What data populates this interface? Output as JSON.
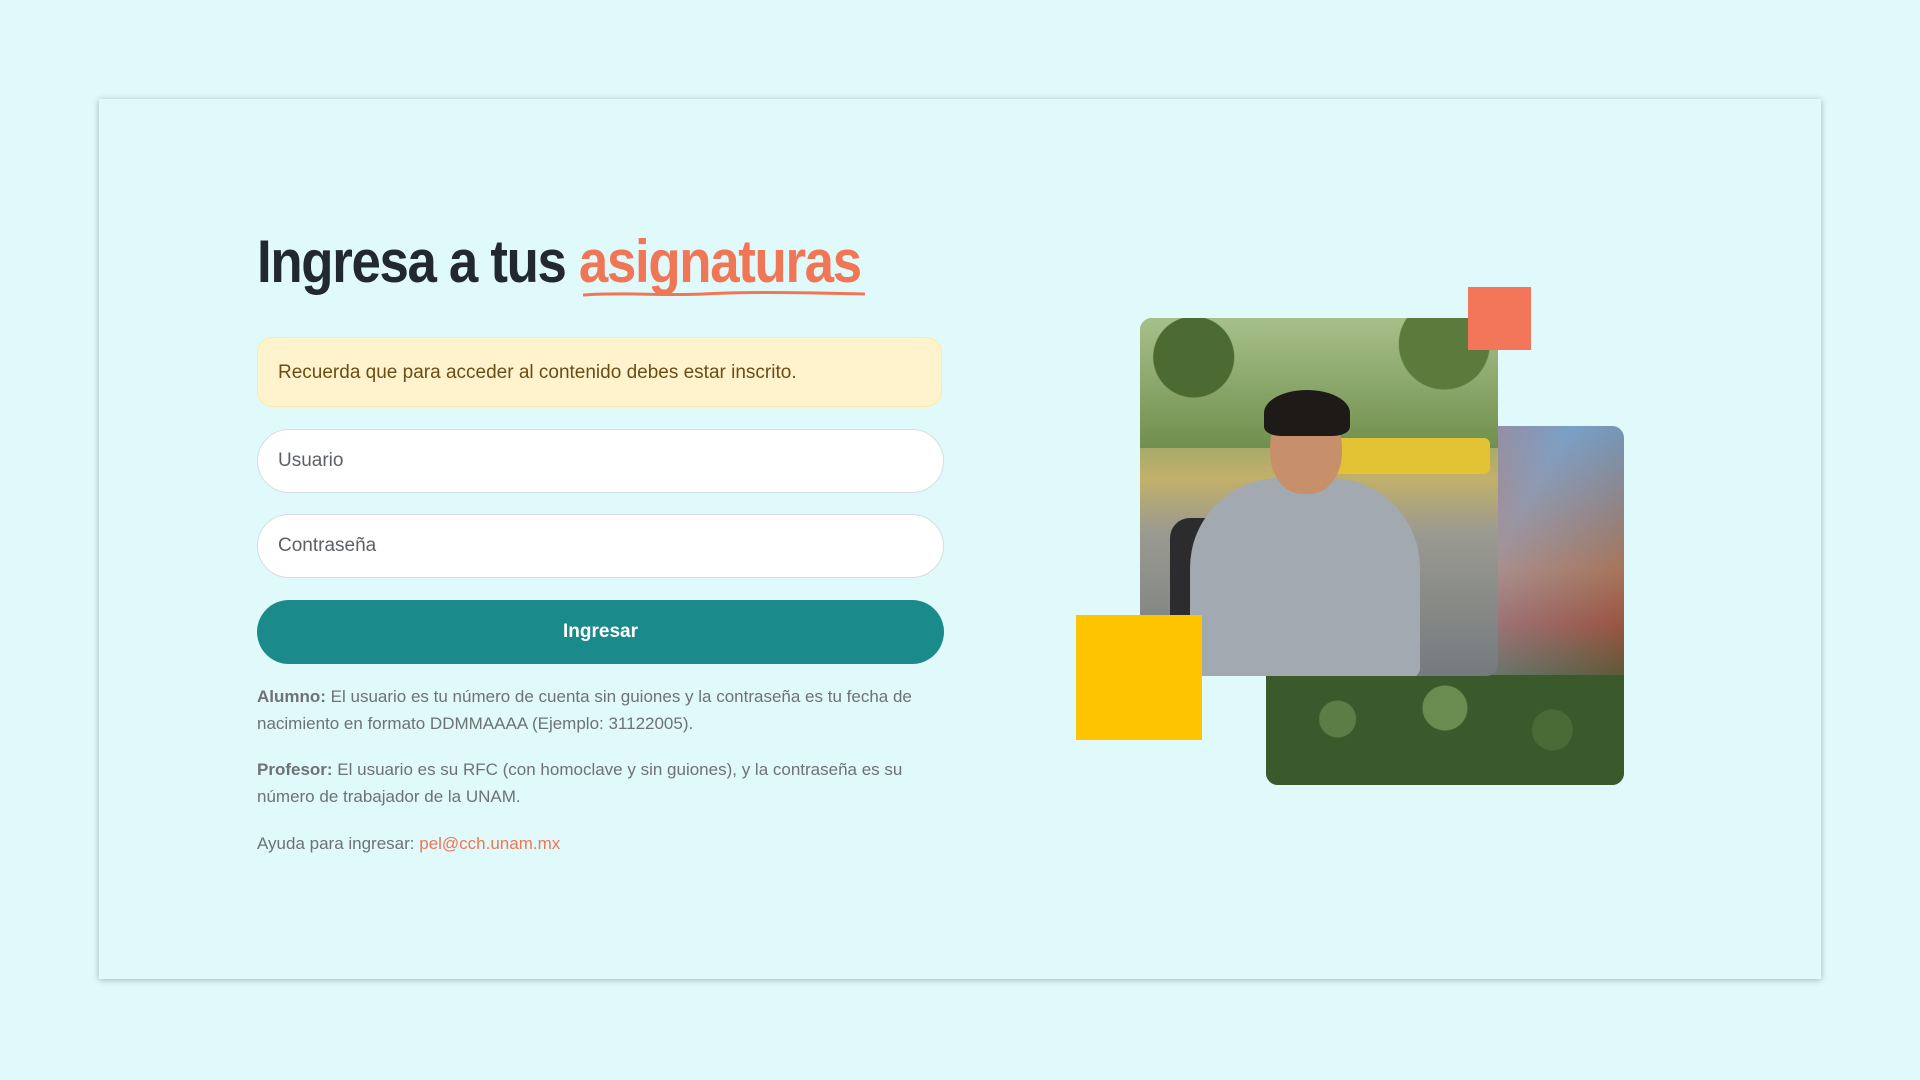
{
  "page": {
    "background": "#e0f9fa",
    "accent_color": "#f07656",
    "primary_button_color": "#1a8b8a",
    "notice_color": "#fff3cd",
    "decor_square_colors": [
      "#f4765a",
      "#ffc400"
    ]
  },
  "heading": {
    "prefix": "Ingresa a tus",
    "highlight": "asignaturas"
  },
  "notice": {
    "text": "Recuerda que para acceder al contenido debes estar inscrito."
  },
  "form": {
    "username_placeholder": "Usuario",
    "password_placeholder": "Contraseña",
    "submit_label": "Ingresar"
  },
  "help": {
    "alumno_label": "Alumno:",
    "alumno_text": " El usuario es tu número de cuenta sin guiones y la contraseña es tu fecha de nacimiento en formato DDMMAAAA (Ejemplo: 31122005).",
    "profesor_label": "Profesor:",
    "profesor_text": " El usuario es su RFC (con homoclave y sin guiones), y la contraseña es su número de trabajador de la UNAM.",
    "ayuda_label": "Ayuda para ingresar: ",
    "ayuda_email": "pel@cch.unam.mx"
  },
  "images": {
    "front_photo": "student-with-phone-photo",
    "back_photo": "campus-mural-photo"
  }
}
